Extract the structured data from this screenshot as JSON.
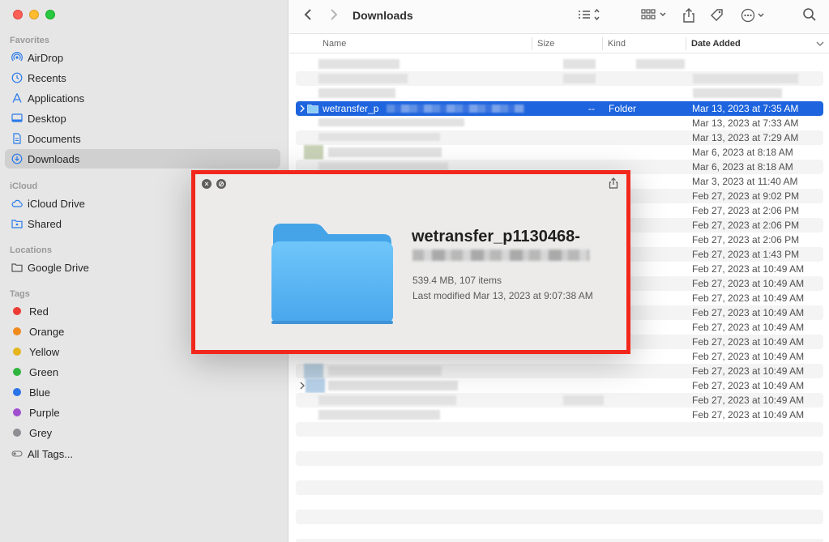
{
  "window": {
    "title": "Downloads"
  },
  "sidebar": {
    "favorites_header": "Favorites",
    "favorites": [
      {
        "label": "AirDrop",
        "icon": "airdrop-icon"
      },
      {
        "label": "Recents",
        "icon": "clock-icon"
      },
      {
        "label": "Applications",
        "icon": "applications-icon"
      },
      {
        "label": "Desktop",
        "icon": "desktop-icon"
      },
      {
        "label": "Documents",
        "icon": "document-icon"
      },
      {
        "label": "Downloads",
        "icon": "download-icon",
        "selected": true
      }
    ],
    "icloud_header": "iCloud",
    "icloud": [
      {
        "label": "iCloud Drive",
        "icon": "cloud-icon"
      },
      {
        "label": "Shared",
        "icon": "shared-folder-icon"
      }
    ],
    "locations_header": "Locations",
    "locations": [
      {
        "label": "Google Drive",
        "icon": "drive-icon"
      }
    ],
    "tags_header": "Tags",
    "tags": [
      {
        "label": "Red",
        "color": "#ee3b35"
      },
      {
        "label": "Orange",
        "color": "#f08a1c"
      },
      {
        "label": "Yellow",
        "color": "#e4b51d"
      },
      {
        "label": "Green",
        "color": "#30b53e"
      },
      {
        "label": "Blue",
        "color": "#2a73e8"
      },
      {
        "label": "Purple",
        "color": "#a04fcf"
      },
      {
        "label": "Grey",
        "color": "#8e8e93"
      },
      {
        "label": "All Tags...",
        "icon": "all-tags-icon"
      }
    ]
  },
  "columns": {
    "name": "Name",
    "size": "Size",
    "kind": "Kind",
    "date_added": "Date Added"
  },
  "selected_row": {
    "name": "wetransfer_p",
    "size": "--",
    "kind": "Folder",
    "date": "Mar 13, 2023 at 7:35 AM"
  },
  "dates": [
    "Mar 13, 2023 at 7:33 AM",
    "Mar 13, 2023 at 7:29 AM",
    "Mar 6, 2023 at 8:18 AM",
    "Mar 6, 2023 at 8:18 AM",
    "Mar 3, 2023 at 11:40 AM",
    "Feb 27, 2023 at 9:02 PM",
    "Feb 27, 2023 at 2:06 PM",
    "Feb 27, 2023 at 2:06 PM",
    "Feb 27, 2023 at 2:06 PM",
    "Feb 27, 2023 at 1:43 PM",
    "Feb 27, 2023 at 10:49 AM",
    "Feb 27, 2023 at 10:49 AM",
    "Feb 27, 2023 at 10:49 AM",
    "Feb 27, 2023 at 10:49 AM",
    "Feb 27, 2023 at 10:49 AM",
    "Feb 27, 2023 at 10:49 AM",
    "Feb 27, 2023 at 10:49 AM",
    "Feb 27, 2023 at 10:49 AM",
    "Feb 27, 2023 at 10:49 AM",
    "Feb 27, 2023 at 10:49 AM",
    "Feb 27, 2023 at 10:49 AM"
  ],
  "quicklook": {
    "title": "wetransfer_p1130468-",
    "size_items": "539.4 MB, 107 items",
    "modified": "Last modified Mar 13, 2023 at 9:07:38 AM"
  }
}
